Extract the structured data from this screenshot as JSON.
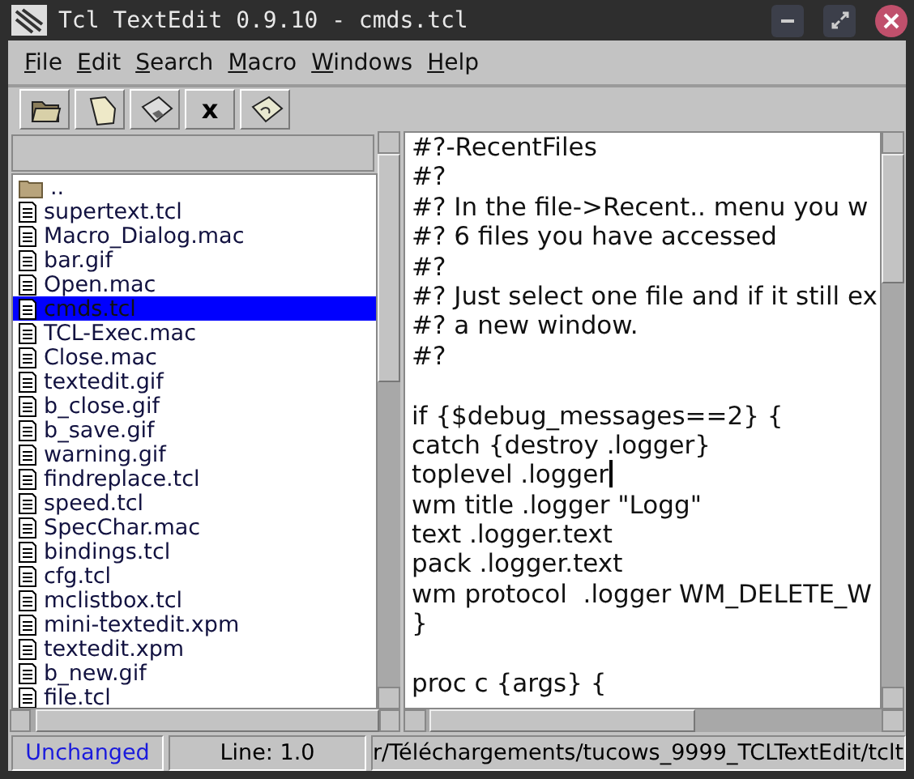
{
  "window": {
    "title": "Tcl TextEdit 0.9.10 - cmds.tcl"
  },
  "menu": [
    "File",
    "Edit",
    "Search",
    "Macro",
    "Windows",
    "Help"
  ],
  "toolbar": [
    {
      "kind": "open"
    },
    {
      "kind": "new"
    },
    {
      "kind": "save"
    },
    {
      "kind": "close",
      "label": "x"
    },
    {
      "kind": "macro"
    }
  ],
  "files": [
    {
      "kind": "folder",
      "name": "..",
      "selected": false
    },
    {
      "kind": "file",
      "name": "supertext.tcl",
      "selected": false
    },
    {
      "kind": "file",
      "name": "Macro_Dialog.mac",
      "selected": false
    },
    {
      "kind": "file",
      "name": "bar.gif",
      "selected": false
    },
    {
      "kind": "file",
      "name": "Open.mac",
      "selected": false
    },
    {
      "kind": "file",
      "name": "cmds.tcl",
      "selected": true
    },
    {
      "kind": "file",
      "name": "TCL-Exec.mac",
      "selected": false
    },
    {
      "kind": "file",
      "name": "Close.mac",
      "selected": false
    },
    {
      "kind": "file",
      "name": "textedit.gif",
      "selected": false
    },
    {
      "kind": "file",
      "name": "b_close.gif",
      "selected": false
    },
    {
      "kind": "file",
      "name": "b_save.gif",
      "selected": false
    },
    {
      "kind": "file",
      "name": "warning.gif",
      "selected": false
    },
    {
      "kind": "file",
      "name": "findreplace.tcl",
      "selected": false
    },
    {
      "kind": "file",
      "name": "speed.tcl",
      "selected": false
    },
    {
      "kind": "file",
      "name": "SpecChar.mac",
      "selected": false
    },
    {
      "kind": "file",
      "name": "bindings.tcl",
      "selected": false
    },
    {
      "kind": "file",
      "name": "cfg.tcl",
      "selected": false
    },
    {
      "kind": "file",
      "name": "mclistbox.tcl",
      "selected": false
    },
    {
      "kind": "file",
      "name": "mini-textedit.xpm",
      "selected": false
    },
    {
      "kind": "file",
      "name": "textedit.xpm",
      "selected": false
    },
    {
      "kind": "file",
      "name": "b_new.gif",
      "selected": false
    },
    {
      "kind": "file",
      "name": "file.tcl",
      "selected": false
    }
  ],
  "editor": {
    "lines": [
      {
        "text": "#?-RecentFiles",
        "caret": false
      },
      {
        "text": "#?",
        "caret": false
      },
      {
        "text": "#? In the file->Recent.. menu you w",
        "caret": false
      },
      {
        "text": "#? 6 files you have accessed",
        "caret": false
      },
      {
        "text": "#?",
        "caret": false
      },
      {
        "text": "#? Just select one file and if it still ex",
        "caret": false
      },
      {
        "text": "#? a new window.",
        "caret": false
      },
      {
        "text": "#?",
        "caret": false
      },
      {
        "kind": "blank"
      },
      {
        "text": "if {$debug_messages==2} {",
        "caret": false
      },
      {
        "text": "catch {destroy .logger}",
        "caret": false
      },
      {
        "text": "toplevel .logger",
        "caret": true
      },
      {
        "text": "wm title .logger \"Logg\"",
        "caret": false
      },
      {
        "text": "text .logger.text",
        "caret": false
      },
      {
        "text": "pack .logger.text",
        "caret": false
      },
      {
        "text": "wm protocol  .logger WM_DELETE_W",
        "caret": false
      },
      {
        "text": "}",
        "caret": false
      },
      {
        "kind": "blank"
      },
      {
        "text": "proc c {args} {",
        "caret": false
      }
    ]
  },
  "status_bar": {
    "modified": false,
    "state": "Unchanged",
    "position": "Line: 1.0",
    "path": "r/Téléchargements/tucows_9999_TCLTextEdit/tclt"
  }
}
